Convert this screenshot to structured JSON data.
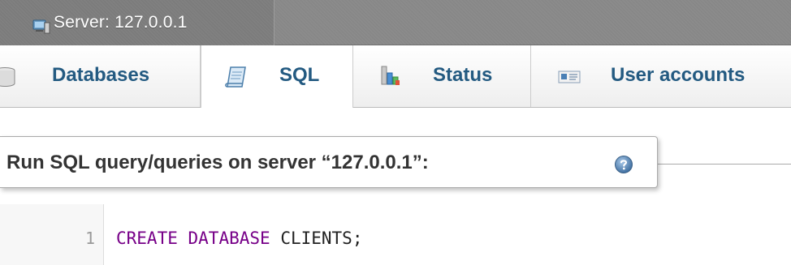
{
  "server_bar": {
    "icon": "server-icon",
    "label": "Server: 127.0.0.1"
  },
  "tabs": [
    {
      "label": "Databases",
      "icon": "database-icon",
      "active": false
    },
    {
      "label": "SQL",
      "icon": "sql-document-icon",
      "active": true
    },
    {
      "label": "Status",
      "icon": "status-chart-icon",
      "active": false
    },
    {
      "label": "User accounts",
      "icon": "user-accounts-icon",
      "active": false
    }
  ],
  "query_panel": {
    "title": "Run SQL query/queries on server “127.0.0.1”:",
    "help_icon": "help-icon"
  },
  "editor": {
    "line_number": "1",
    "keyword_1": "CREATE",
    "keyword_2": "DATABASE",
    "identifier": "CLIENTS;"
  },
  "colors": {
    "tab_text": "#235a81",
    "keyword": "#770088",
    "server_bar": "#888888"
  }
}
